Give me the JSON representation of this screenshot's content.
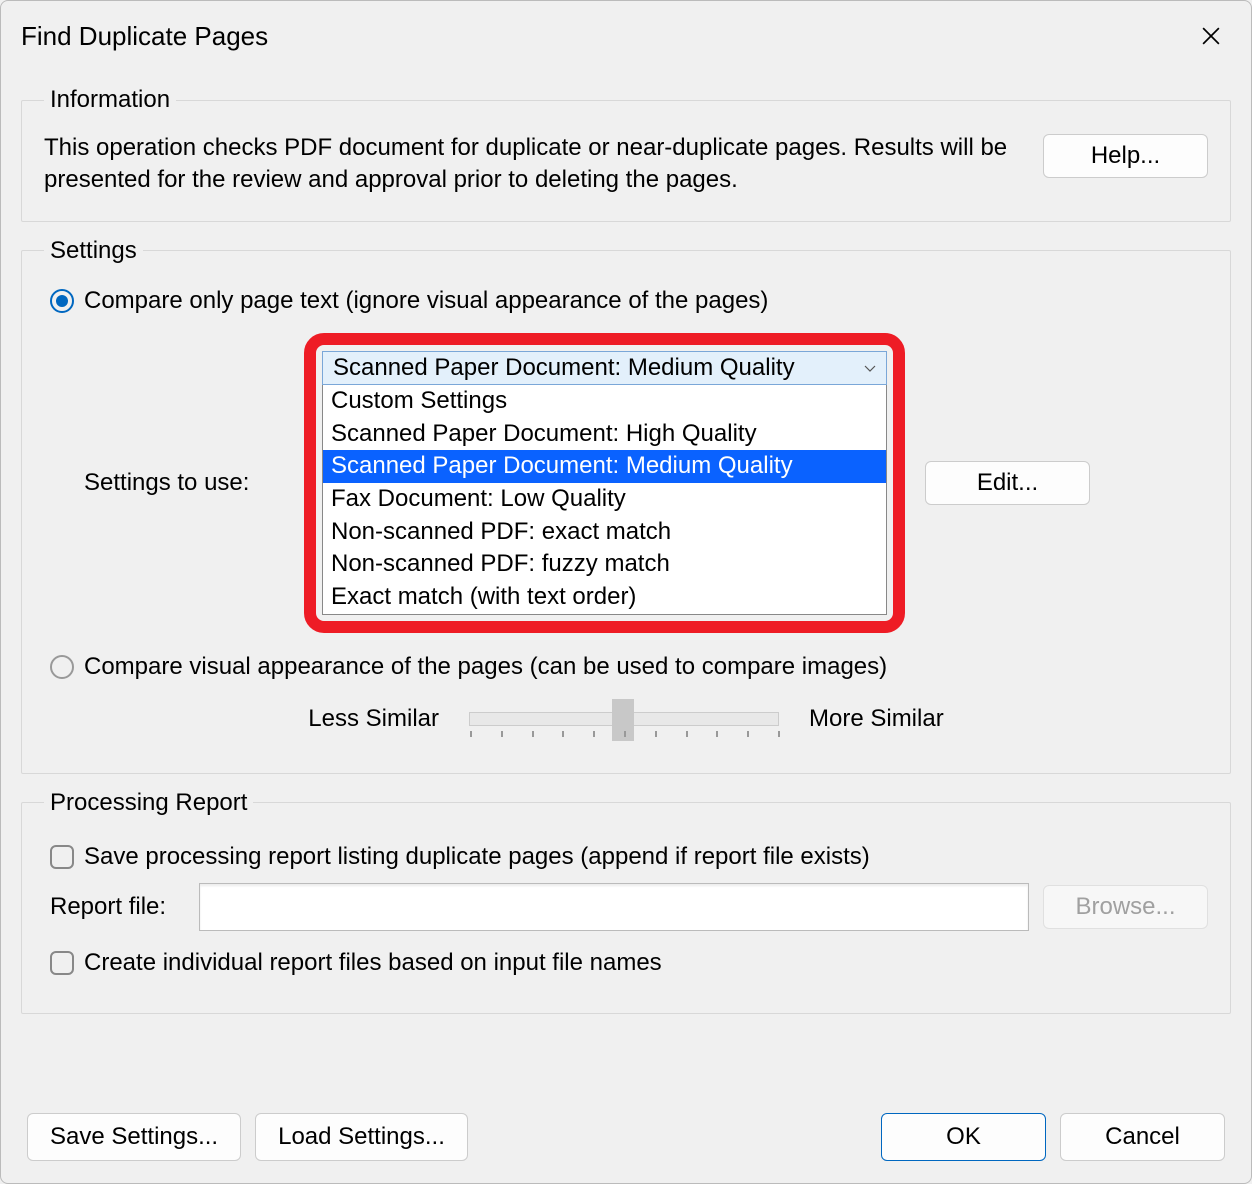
{
  "title": "Find Duplicate Pages",
  "information": {
    "legend": "Information",
    "text": "This operation checks PDF document for duplicate or near-duplicate pages. Results will be presented for the review and approval prior to deleting the pages.",
    "help_label": "Help..."
  },
  "settings": {
    "legend": "Settings",
    "radio_text": "Compare only page text (ignore visual appearance of the pages)",
    "radio_visual": "Compare visual appearance of the pages (can be used to compare images)",
    "settings_to_use_label": "Settings to use:",
    "selected_option": "Scanned Paper Document: Medium Quality",
    "options": [
      "Custom Settings",
      "Scanned Paper Document: High Quality",
      "Scanned Paper Document: Medium Quality",
      "Fax Document: Low Quality",
      "Non-scanned PDF: exact match",
      "Non-scanned PDF: fuzzy match",
      "Exact match (with text order)"
    ],
    "selected_index": 2,
    "edit_label": "Edit...",
    "slider": {
      "less": "Less Similar",
      "more": "More Similar"
    }
  },
  "report": {
    "legend": "Processing Report",
    "save_label": "Save processing report listing duplicate pages (append if report file exists)",
    "file_label": "Report file:",
    "file_value": "",
    "browse_label": "Browse...",
    "individual_label": "Create individual report files based on input file names"
  },
  "buttons": {
    "save_settings": "Save Settings...",
    "load_settings": "Load Settings...",
    "ok": "OK",
    "cancel": "Cancel"
  }
}
